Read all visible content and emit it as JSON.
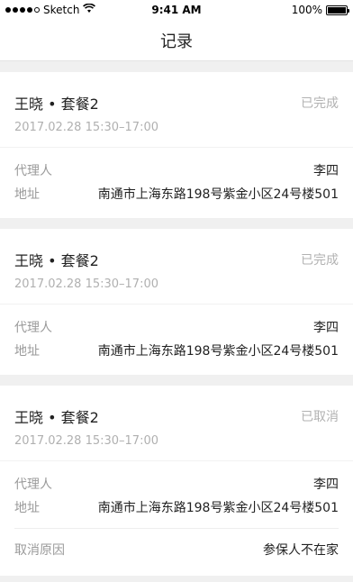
{
  "statusbar": {
    "carrier": "Sketch",
    "time": "9:41 AM",
    "battery": "100%",
    "battery_level": 1.0
  },
  "navbar": {
    "title": "记录"
  },
  "records": [
    {
      "title": "王晓 • 套餐2",
      "status": "已完成",
      "time": "2017.02.28 15:30–17:00",
      "agent_label": "代理人",
      "agent_value": "李四",
      "address_label": "地址",
      "address_value": "南通市上海东路198号紫金小区24号楼501"
    },
    {
      "title": "王晓 • 套餐2",
      "status": "已完成",
      "time": "2017.02.28 15:30–17:00",
      "agent_label": "代理人",
      "agent_value": "李四",
      "address_label": "地址",
      "address_value": "南通市上海东路198号紫金小区24号楼501"
    },
    {
      "title": "王晓 • 套餐2",
      "status": "已取消",
      "time": "2017.02.28 15:30–17:00",
      "agent_label": "代理人",
      "agent_value": "李四",
      "address_label": "地址",
      "address_value": "南通市上海东路198号紫金小区24号楼501",
      "cancel_label": "取消原因",
      "cancel_value": "参保人不在家"
    }
  ]
}
